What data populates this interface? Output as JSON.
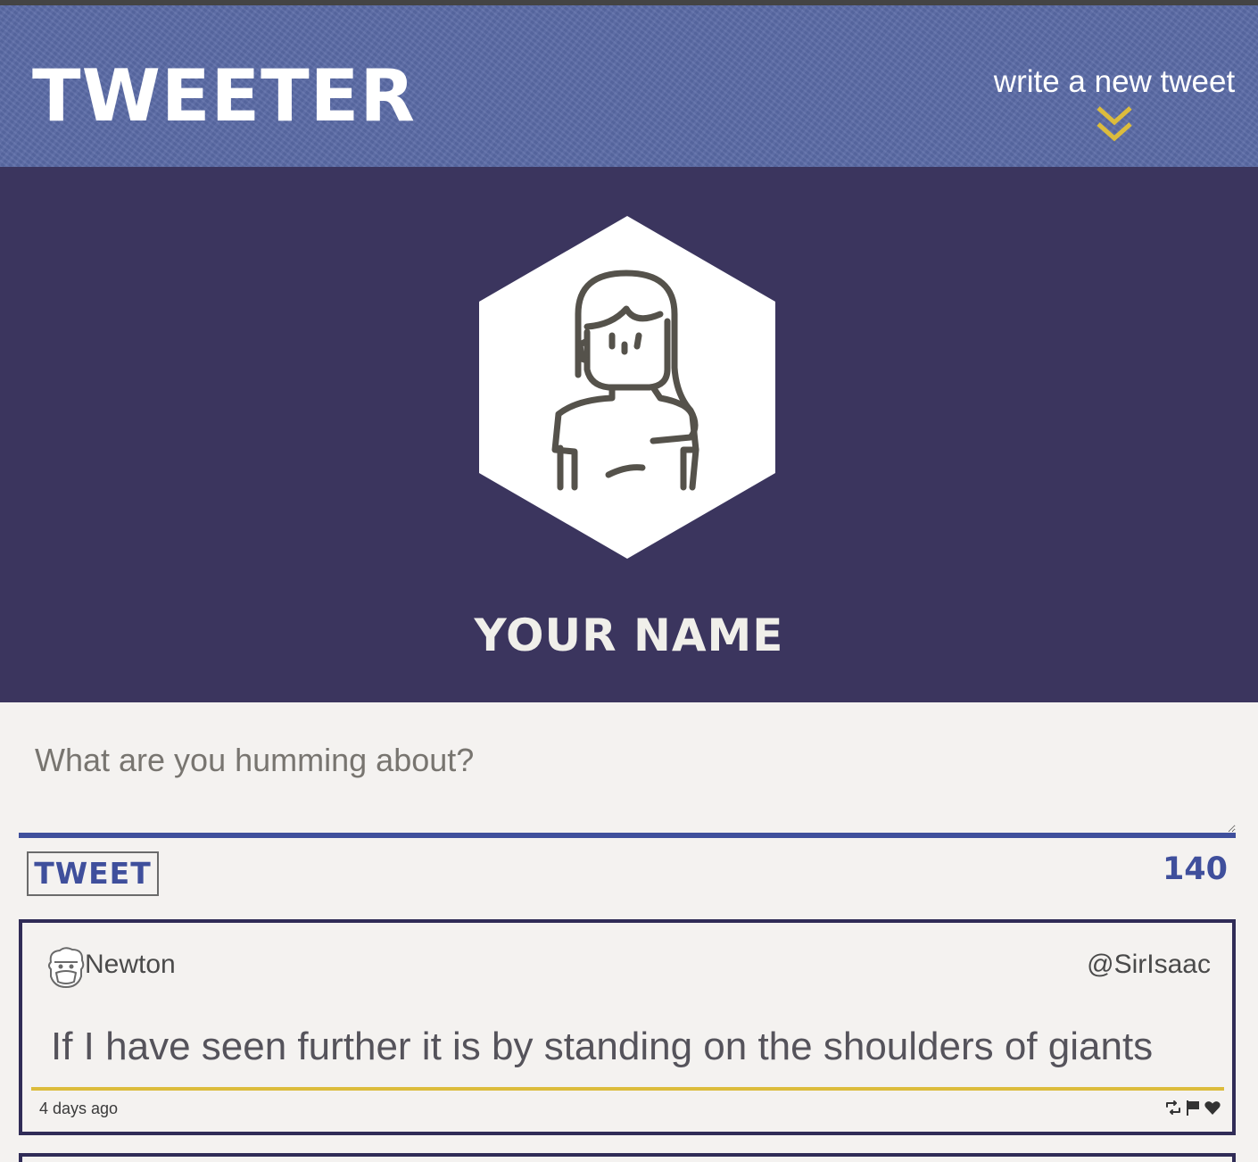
{
  "header": {
    "brand": "TWEETER",
    "compose_label": "write a new tweet",
    "compose_icon": "double-chevron-down-icon",
    "colors": {
      "nav_bg": "#5a6aa6",
      "accent": "#dcbc3c"
    }
  },
  "profile": {
    "name": "YOUR NAME",
    "avatar_icon": "woman-avatar-icon",
    "colors": {
      "bg": "#3b355e"
    }
  },
  "composer": {
    "placeholder": "What are you humming about?",
    "value": "",
    "submit_label": "TWEET",
    "char_counter": "140",
    "colors": {
      "primary": "#3f4f9c"
    }
  },
  "tweets": [
    {
      "avatar_icon": "bearded-man-avatar-icon",
      "name": "Newton",
      "handle": "@SirIsaac",
      "content": "If I have seen further it is by standing on the shoulders of giants",
      "timestamp": "4 days ago",
      "actions": [
        "retweet-icon",
        "flag-icon",
        "heart-icon"
      ]
    }
  ]
}
